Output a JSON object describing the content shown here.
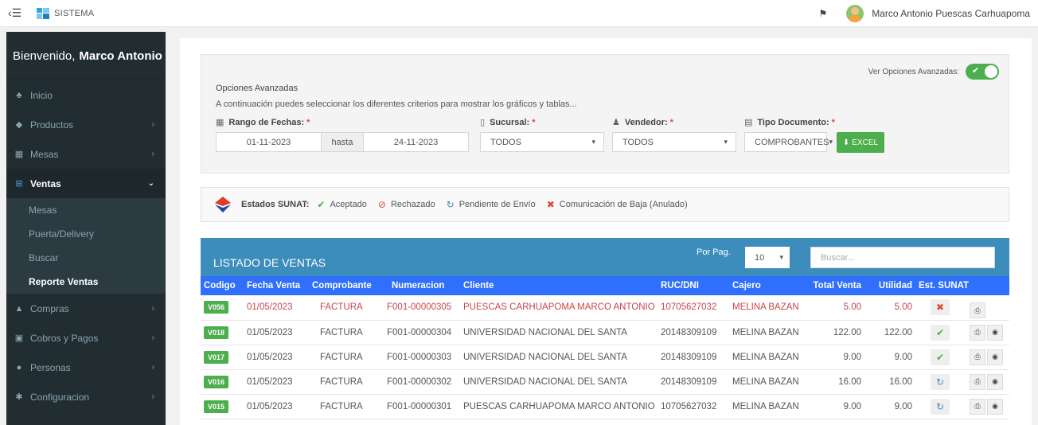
{
  "topbar": {
    "app_name": "SISTEMA",
    "user_name": "Marco Antonio Puescas Carhuapoma"
  },
  "sidebar": {
    "welcome_prefix": "Bienvenido,",
    "welcome_name": "Marco Antonio",
    "items": [
      {
        "label": "Inicio",
        "icon": "dashboard-icon"
      },
      {
        "label": "Productos",
        "icon": "box-icon"
      },
      {
        "label": "Mesas",
        "icon": "grid-icon"
      },
      {
        "label": "Ventas",
        "icon": "cart-icon"
      },
      {
        "label": "Compras",
        "icon": "bank-icon"
      },
      {
        "label": "Cobros y Pagos",
        "icon": "money-icon"
      },
      {
        "label": "Personas",
        "icon": "user-icon"
      },
      {
        "label": "Configuracion",
        "icon": "gear-icon"
      }
    ],
    "ventas_sub": [
      "Mesas",
      "Puerta/Delivery",
      "Buscar",
      "Reporte Ventas"
    ]
  },
  "filters": {
    "advanced_toggle_label": "Ver Opciones Avanzadas:",
    "title": "Opciones Avanzadas",
    "description": "A continuación puedes seleccionar los diferentes criterios para mostrar los gráficos y tablas...",
    "date_label": "Rango de Fechas:",
    "date_from": "01-11-2023",
    "date_sep": "hasta",
    "date_to": "24-11-2023",
    "branch_label": "Sucursal:",
    "branch_value": "TODOS",
    "seller_label": "Vendedor:",
    "seller_value": "TODOS",
    "doc_label": "Tipo Documento:",
    "doc_value": "COMPROBANTES",
    "required_mark": "*",
    "excel_label": "EXCEL"
  },
  "sunat": {
    "label": "Estados SUNAT:",
    "states": [
      {
        "label": "Aceptado",
        "icon": "check-icon",
        "color": "#4cae4c"
      },
      {
        "label": "Rechazado",
        "icon": "ban-icon",
        "color": "#dd4b39"
      },
      {
        "label": "Pendiente de Envío",
        "icon": "refresh-icon",
        "color": "#3c8dbc"
      },
      {
        "label": "Comunicación de Baja (Anulado)",
        "icon": "times-circle-icon",
        "color": "#dd4b39"
      }
    ]
  },
  "list": {
    "title": "LISTADO DE VENTAS",
    "per_page_label": "Por Pag.",
    "per_page_value": "10",
    "search_placeholder": "Buscar...",
    "columns": [
      "Codigo",
      "Fecha Venta",
      "Comprobante",
      "Numeracion",
      "Cliente",
      "RUC/DNI",
      "Cajero",
      "Total Venta",
      "Utilidad",
      "Est. SUNAT"
    ],
    "rows": [
      {
        "codigo": "V056",
        "fecha": "01/05/2023",
        "comprobante": "FACTURA",
        "numeracion": "F001-00000305",
        "cliente": "PUESCAS CARHUAPOMA MARCO ANTONIO",
        "ruc": "10705627032",
        "cajero": "MELINA BAZAN",
        "total": "5.00",
        "utilidad": "5.00",
        "estado": "anulado",
        "red": true,
        "view": false
      },
      {
        "codigo": "V018",
        "fecha": "01/05/2023",
        "comprobante": "FACTURA",
        "numeracion": "F001-00000304",
        "cliente": "UNIVERSIDAD NACIONAL DEL SANTA",
        "ruc": "20148309109",
        "cajero": "MELINA BAZAN",
        "total": "122.00",
        "utilidad": "122.00",
        "estado": "aceptado",
        "red": false,
        "view": true
      },
      {
        "codigo": "V017",
        "fecha": "01/05/2023",
        "comprobante": "FACTURA",
        "numeracion": "F001-00000303",
        "cliente": "UNIVERSIDAD NACIONAL DEL SANTA",
        "ruc": "20148309109",
        "cajero": "MELINA BAZAN",
        "total": "9.00",
        "utilidad": "9.00",
        "estado": "aceptado",
        "red": false,
        "view": true
      },
      {
        "codigo": "V016",
        "fecha": "01/05/2023",
        "comprobante": "FACTURA",
        "numeracion": "F001-00000302",
        "cliente": "UNIVERSIDAD NACIONAL DEL SANTA",
        "ruc": "20148309109",
        "cajero": "MELINA BAZAN",
        "total": "16.00",
        "utilidad": "16.00",
        "estado": "pendiente",
        "red": false,
        "view": true
      },
      {
        "codigo": "V015",
        "fecha": "01/05/2023",
        "comprobante": "FACTURA",
        "numeracion": "F001-00000301",
        "cliente": "PUESCAS CARHUAPOMA MARCO ANTONIO",
        "ruc": "10705627032",
        "cajero": "MELINA BAZAN",
        "total": "9.00",
        "utilidad": "9.00",
        "estado": "pendiente",
        "red": false,
        "view": true
      }
    ]
  },
  "colors": {
    "sidebar_bg": "#222d32",
    "header_blue": "#3c8dbc",
    "table_head_blue": "#2f6ffc",
    "success_green": "#4cae4c",
    "danger_red": "#dd4b39"
  }
}
